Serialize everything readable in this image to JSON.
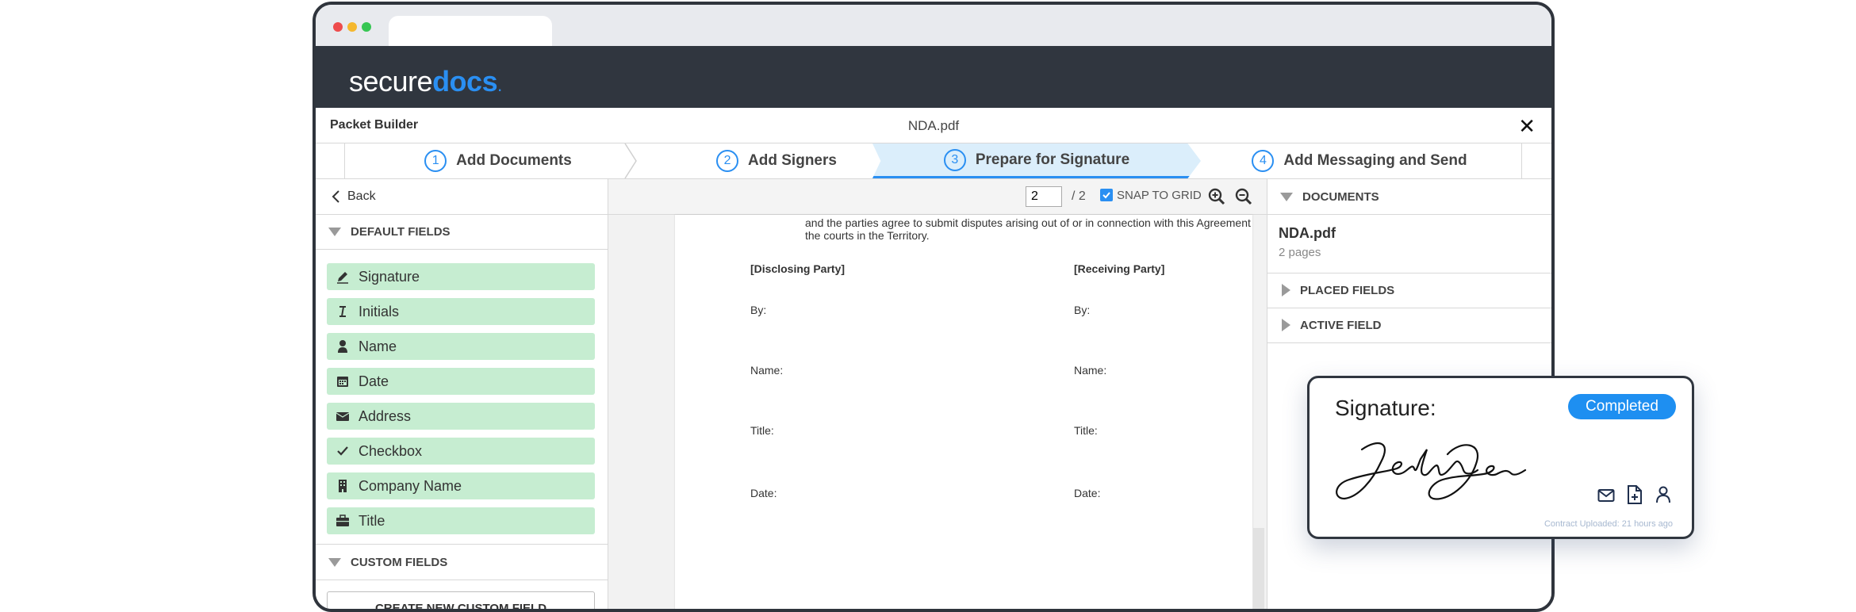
{
  "app": {
    "brand_left": "secure",
    "brand_right": "docs",
    "accent": "#2a8ff2"
  },
  "header": {
    "title": "Packet Builder",
    "document": "NDA.pdf",
    "close_glyph": "✕"
  },
  "steps": [
    {
      "num": "1",
      "label": "Add Documents"
    },
    {
      "num": "2",
      "label": "Add Signers"
    },
    {
      "num": "3",
      "label": "Prepare for Signature",
      "active": true
    },
    {
      "num": "4",
      "label": "Add Messaging and Send"
    }
  ],
  "left_panel": {
    "back_label": "Back",
    "default_fields_header": "DEFAULT FIELDS",
    "fields": [
      {
        "label": "Signature",
        "icon": "pen-icon"
      },
      {
        "label": "Initials",
        "icon": "text-cursor-icon"
      },
      {
        "label": "Name",
        "icon": "person-icon"
      },
      {
        "label": "Date",
        "icon": "calendar-icon"
      },
      {
        "label": "Address",
        "icon": "envelope-icon"
      },
      {
        "label": "Checkbox",
        "icon": "checkmark-icon"
      },
      {
        "label": "Company Name",
        "icon": "building-icon"
      },
      {
        "label": "Title",
        "icon": "briefcase-icon"
      }
    ],
    "custom_fields_header": "CUSTOM FIELDS",
    "create_custom_label": "CREATE NEW CUSTOM FIELD"
  },
  "viewer": {
    "page_value": "2",
    "page_total": "/ 2",
    "snap_label": "SNAP TO GRID",
    "snap_checked": true,
    "doc_text_line1": "and the parties agree to submit disputes arising out of or in connection with this Agreement",
    "doc_text_line2": "the courts in the Territory.",
    "left_party": {
      "heading": "[Disclosing Party]",
      "by": "By:",
      "name": "Name:",
      "title": "Title:",
      "date": "Date:"
    },
    "right_party": {
      "heading": "[Receiving Party]",
      "by": "By:",
      "name": "Name:",
      "title": "Title:",
      "date": "Date:"
    }
  },
  "right_panel": {
    "documents_header": "DOCUMENTS",
    "doc_name": "NDA.pdf",
    "doc_pages": "2 pages",
    "placed_fields_header": "PLACED FIELDS",
    "active_field_header": "ACTIVE FIELD"
  },
  "signature_card": {
    "title": "Signature:",
    "status": "Completed",
    "signature_text": "John Doe",
    "footer": "Contract Uploaded: 21 hours ago",
    "icons": [
      "envelope-icon",
      "file-plus-icon",
      "person-icon"
    ]
  }
}
